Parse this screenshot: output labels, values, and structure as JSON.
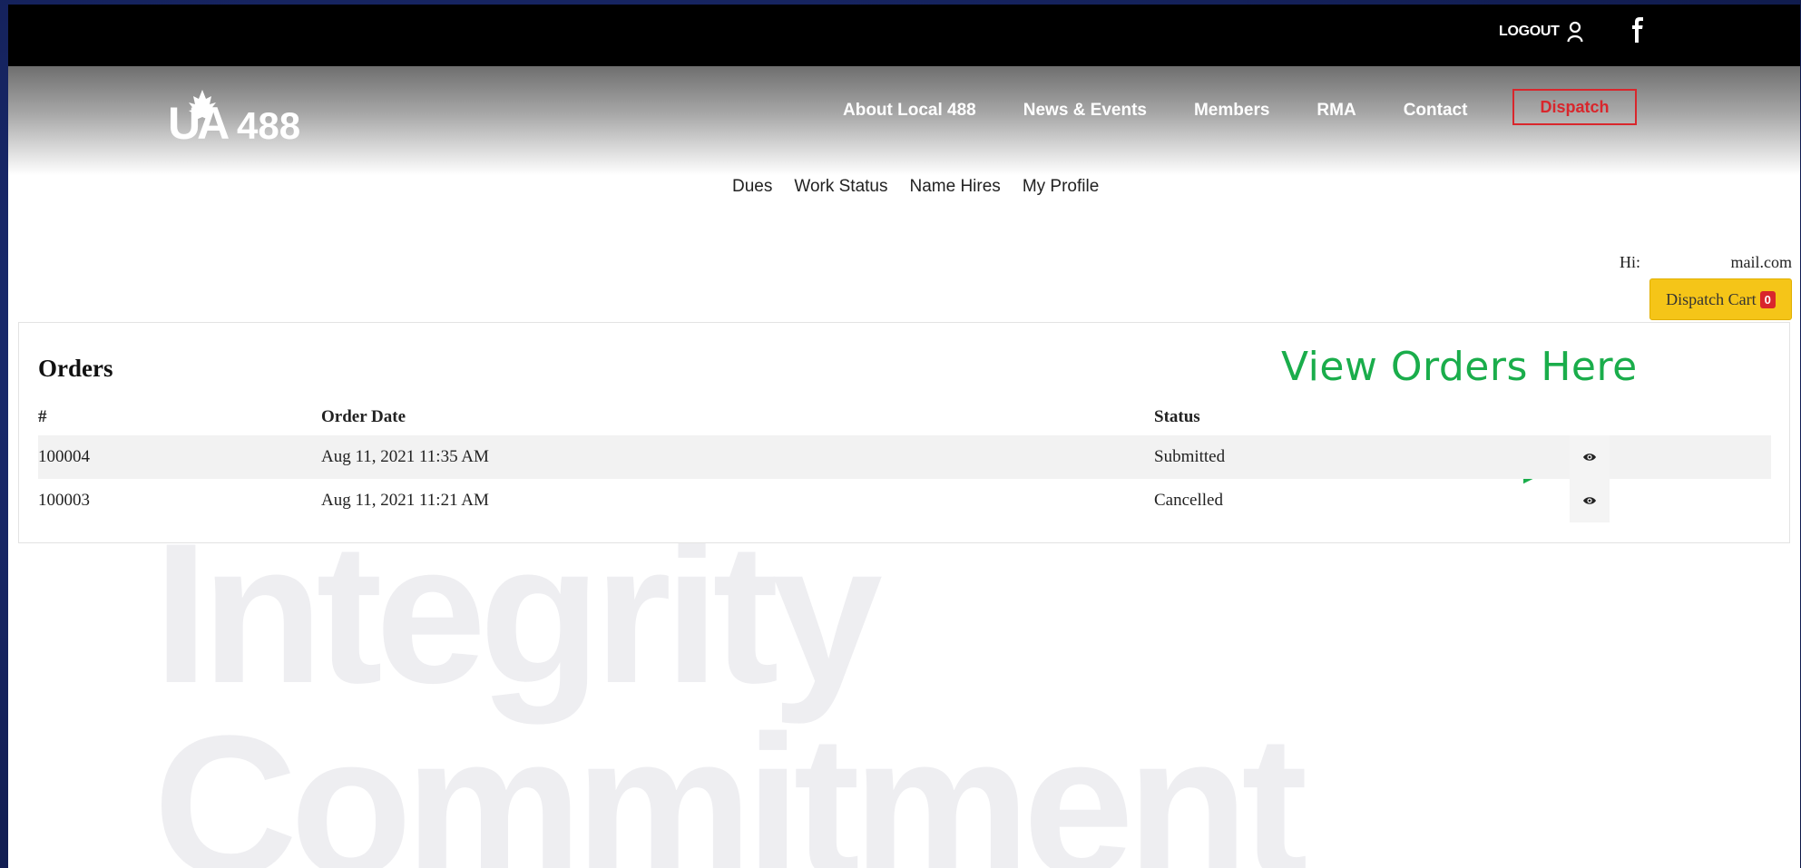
{
  "topbar": {
    "logout_label": "LOGOUT",
    "user_icon": "user-icon",
    "facebook_icon": "facebook-icon"
  },
  "header": {
    "logo_text": "UA 488",
    "nav": [
      {
        "label": "About Local 488"
      },
      {
        "label": "News & Events"
      },
      {
        "label": "Members"
      },
      {
        "label": "RMA"
      },
      {
        "label": "Contact"
      }
    ],
    "dispatch_label": "Dispatch"
  },
  "subnav": {
    "items": [
      "Dues",
      "Work Status",
      "Name Hires",
      "My Profile"
    ]
  },
  "user": {
    "greeting": "Hi:",
    "email_fragment": "mail.com"
  },
  "cart": {
    "label": "Dispatch Cart",
    "count": "0"
  },
  "orders": {
    "title": "Orders",
    "annotation": "View Orders Here",
    "columns": [
      "#",
      "Order Date",
      "Status"
    ],
    "rows": [
      {
        "id": "100004",
        "date": "Aug 11, 2021 11:35 AM",
        "status": "Submitted"
      },
      {
        "id": "100003",
        "date": "Aug 11, 2021 11:21 AM",
        "status": "Cancelled"
      }
    ]
  },
  "watermark": {
    "line1": "Integrity",
    "line2": "Commitment"
  },
  "colors": {
    "accent_red": "#d9262c",
    "cart_yellow": "#f5c518",
    "annotation_green": "#1aad4b",
    "background_blue": "#1b2a6b"
  }
}
